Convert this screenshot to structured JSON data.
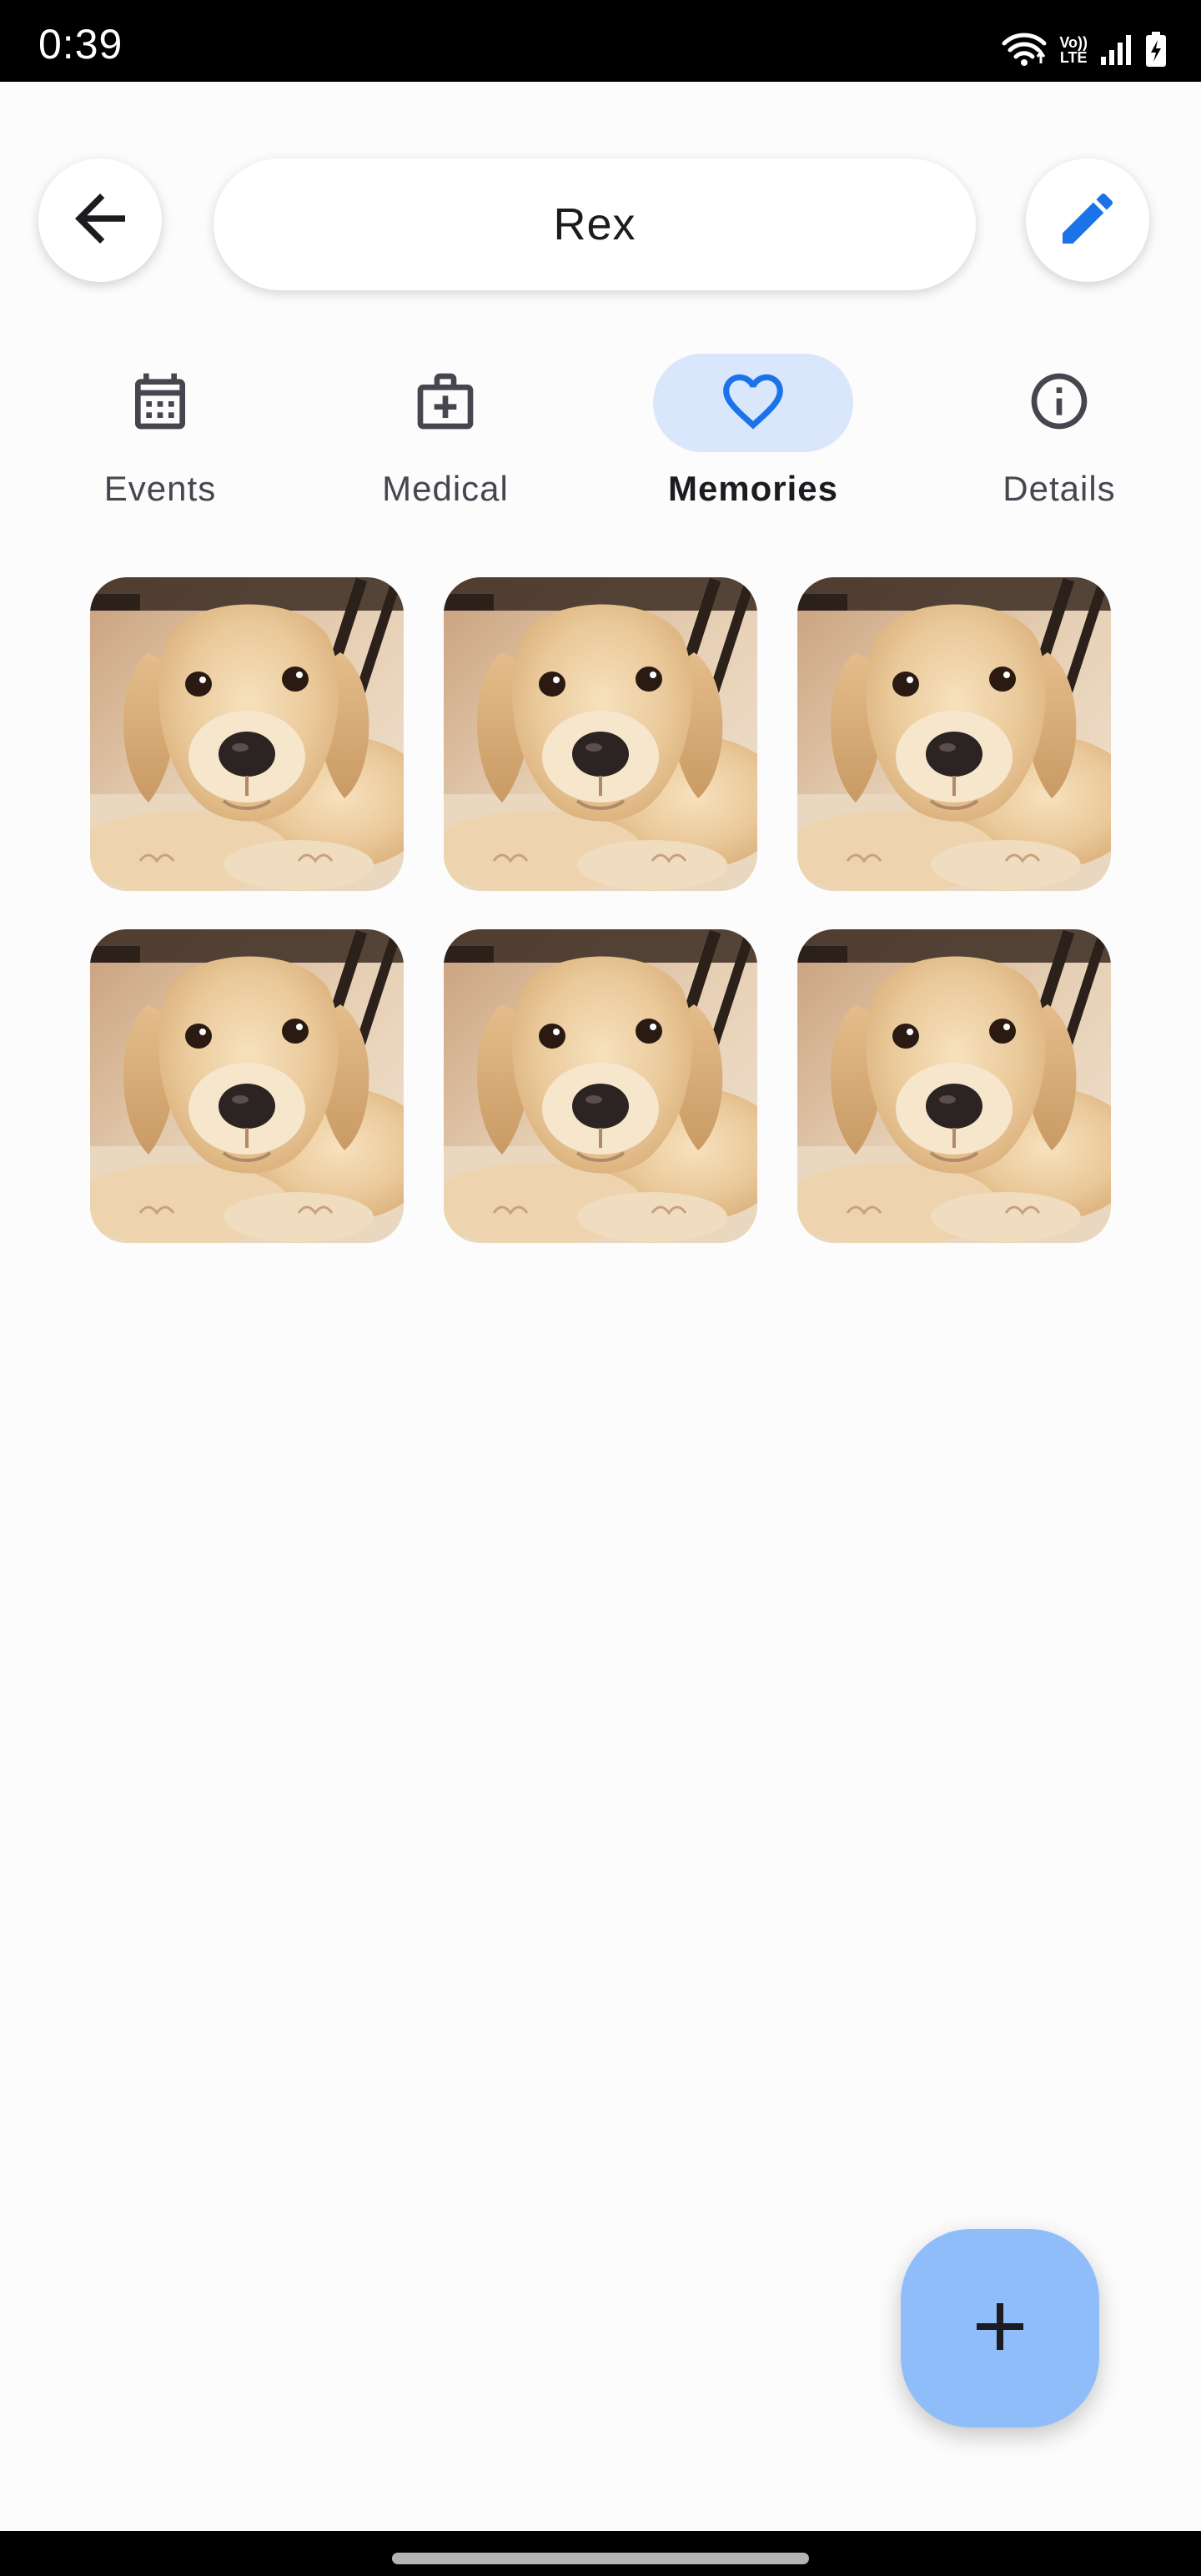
{
  "status_bar": {
    "time": "0:39",
    "lte_top": "Vo))",
    "lte_bottom": "LTE",
    "icons": [
      "wifi-icon",
      "volte-icon",
      "signal-icon",
      "battery-charging-icon"
    ]
  },
  "header": {
    "title": "Rex",
    "back_icon": "arrow-back-icon",
    "edit_icon": "pencil-icon"
  },
  "tabs": [
    {
      "label": "Events",
      "icon": "calendar-icon",
      "active": false
    },
    {
      "label": "Medical",
      "icon": "medical-kit-icon",
      "active": false
    },
    {
      "label": "Memories",
      "icon": "heart-icon",
      "active": true
    },
    {
      "label": "Details",
      "icon": "info-icon",
      "active": false
    }
  ],
  "memories": {
    "photos": [
      {
        "subject": "labrador-puppy"
      },
      {
        "subject": "labrador-puppy"
      },
      {
        "subject": "labrador-puppy"
      },
      {
        "subject": "labrador-puppy"
      },
      {
        "subject": "labrador-puppy"
      },
      {
        "subject": "labrador-puppy"
      }
    ]
  },
  "fab": {
    "icon": "plus-icon"
  },
  "colors": {
    "accent": "#1a73e8",
    "tab_active_bg": "#d9e6fb",
    "fab_bg": "#8fbdf9",
    "background": "#fdfcfc"
  }
}
